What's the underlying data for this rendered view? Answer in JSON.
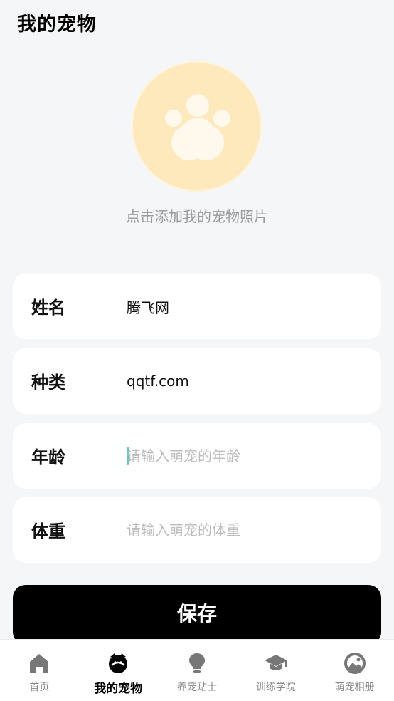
{
  "header": {
    "title": "我的宠物"
  },
  "avatar": {
    "hint": "点击添加我的宠物照片",
    "icon": "paw-icon",
    "bg_color": "#fde9bb"
  },
  "form": {
    "name": {
      "label": "姓名",
      "value": "腾飞网",
      "placeholder": ""
    },
    "species": {
      "label": "种类",
      "value": "qqtf.com",
      "placeholder": ""
    },
    "age": {
      "label": "年龄",
      "value": "",
      "placeholder": "请输入萌宠的年龄"
    },
    "weight": {
      "label": "体重",
      "value": "",
      "placeholder": "请输入萌宠的体重"
    }
  },
  "save_button": {
    "label": "保存"
  },
  "tabbar": {
    "active_index": 1,
    "items": [
      {
        "label": "首页",
        "icon": "home-icon"
      },
      {
        "label": "我的宠物",
        "icon": "pet-icon"
      },
      {
        "label": "养宠贴士",
        "icon": "lightbulb-icon"
      },
      {
        "label": "训练学院",
        "icon": "graduation-cap-icon"
      },
      {
        "label": "萌宠相册",
        "icon": "album-icon"
      }
    ]
  }
}
